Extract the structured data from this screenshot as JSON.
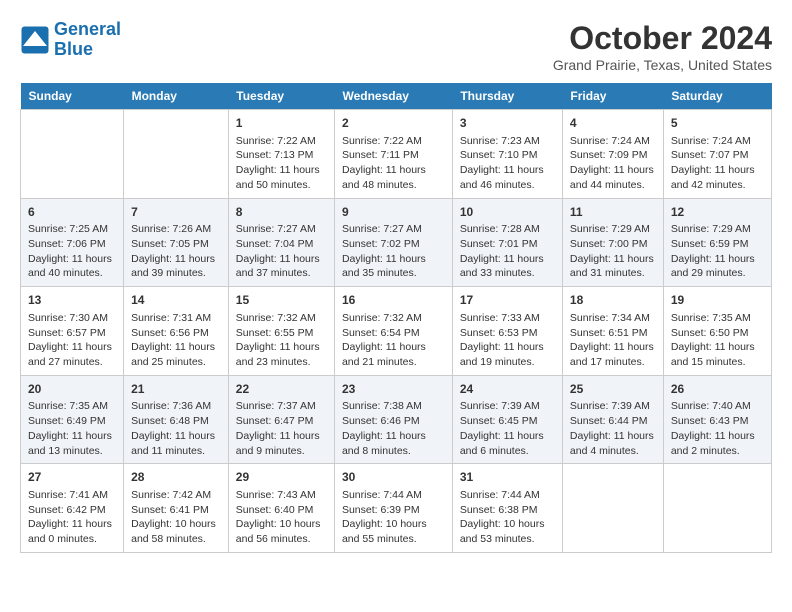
{
  "logo": {
    "line1": "General",
    "line2": "Blue"
  },
  "title": "October 2024",
  "subtitle": "Grand Prairie, Texas, United States",
  "headers": [
    "Sunday",
    "Monday",
    "Tuesday",
    "Wednesday",
    "Thursday",
    "Friday",
    "Saturday"
  ],
  "weeks": [
    [
      {
        "day": "",
        "info": ""
      },
      {
        "day": "",
        "info": ""
      },
      {
        "day": "1",
        "info": "Sunrise: 7:22 AM\nSunset: 7:13 PM\nDaylight: 11 hours and 50 minutes."
      },
      {
        "day": "2",
        "info": "Sunrise: 7:22 AM\nSunset: 7:11 PM\nDaylight: 11 hours and 48 minutes."
      },
      {
        "day": "3",
        "info": "Sunrise: 7:23 AM\nSunset: 7:10 PM\nDaylight: 11 hours and 46 minutes."
      },
      {
        "day": "4",
        "info": "Sunrise: 7:24 AM\nSunset: 7:09 PM\nDaylight: 11 hours and 44 minutes."
      },
      {
        "day": "5",
        "info": "Sunrise: 7:24 AM\nSunset: 7:07 PM\nDaylight: 11 hours and 42 minutes."
      }
    ],
    [
      {
        "day": "6",
        "info": "Sunrise: 7:25 AM\nSunset: 7:06 PM\nDaylight: 11 hours and 40 minutes."
      },
      {
        "day": "7",
        "info": "Sunrise: 7:26 AM\nSunset: 7:05 PM\nDaylight: 11 hours and 39 minutes."
      },
      {
        "day": "8",
        "info": "Sunrise: 7:27 AM\nSunset: 7:04 PM\nDaylight: 11 hours and 37 minutes."
      },
      {
        "day": "9",
        "info": "Sunrise: 7:27 AM\nSunset: 7:02 PM\nDaylight: 11 hours and 35 minutes."
      },
      {
        "day": "10",
        "info": "Sunrise: 7:28 AM\nSunset: 7:01 PM\nDaylight: 11 hours and 33 minutes."
      },
      {
        "day": "11",
        "info": "Sunrise: 7:29 AM\nSunset: 7:00 PM\nDaylight: 11 hours and 31 minutes."
      },
      {
        "day": "12",
        "info": "Sunrise: 7:29 AM\nSunset: 6:59 PM\nDaylight: 11 hours and 29 minutes."
      }
    ],
    [
      {
        "day": "13",
        "info": "Sunrise: 7:30 AM\nSunset: 6:57 PM\nDaylight: 11 hours and 27 minutes."
      },
      {
        "day": "14",
        "info": "Sunrise: 7:31 AM\nSunset: 6:56 PM\nDaylight: 11 hours and 25 minutes."
      },
      {
        "day": "15",
        "info": "Sunrise: 7:32 AM\nSunset: 6:55 PM\nDaylight: 11 hours and 23 minutes."
      },
      {
        "day": "16",
        "info": "Sunrise: 7:32 AM\nSunset: 6:54 PM\nDaylight: 11 hours and 21 minutes."
      },
      {
        "day": "17",
        "info": "Sunrise: 7:33 AM\nSunset: 6:53 PM\nDaylight: 11 hours and 19 minutes."
      },
      {
        "day": "18",
        "info": "Sunrise: 7:34 AM\nSunset: 6:51 PM\nDaylight: 11 hours and 17 minutes."
      },
      {
        "day": "19",
        "info": "Sunrise: 7:35 AM\nSunset: 6:50 PM\nDaylight: 11 hours and 15 minutes."
      }
    ],
    [
      {
        "day": "20",
        "info": "Sunrise: 7:35 AM\nSunset: 6:49 PM\nDaylight: 11 hours and 13 minutes."
      },
      {
        "day": "21",
        "info": "Sunrise: 7:36 AM\nSunset: 6:48 PM\nDaylight: 11 hours and 11 minutes."
      },
      {
        "day": "22",
        "info": "Sunrise: 7:37 AM\nSunset: 6:47 PM\nDaylight: 11 hours and 9 minutes."
      },
      {
        "day": "23",
        "info": "Sunrise: 7:38 AM\nSunset: 6:46 PM\nDaylight: 11 hours and 8 minutes."
      },
      {
        "day": "24",
        "info": "Sunrise: 7:39 AM\nSunset: 6:45 PM\nDaylight: 11 hours and 6 minutes."
      },
      {
        "day": "25",
        "info": "Sunrise: 7:39 AM\nSunset: 6:44 PM\nDaylight: 11 hours and 4 minutes."
      },
      {
        "day": "26",
        "info": "Sunrise: 7:40 AM\nSunset: 6:43 PM\nDaylight: 11 hours and 2 minutes."
      }
    ],
    [
      {
        "day": "27",
        "info": "Sunrise: 7:41 AM\nSunset: 6:42 PM\nDaylight: 11 hours and 0 minutes."
      },
      {
        "day": "28",
        "info": "Sunrise: 7:42 AM\nSunset: 6:41 PM\nDaylight: 10 hours and 58 minutes."
      },
      {
        "day": "29",
        "info": "Sunrise: 7:43 AM\nSunset: 6:40 PM\nDaylight: 10 hours and 56 minutes."
      },
      {
        "day": "30",
        "info": "Sunrise: 7:44 AM\nSunset: 6:39 PM\nDaylight: 10 hours and 55 minutes."
      },
      {
        "day": "31",
        "info": "Sunrise: 7:44 AM\nSunset: 6:38 PM\nDaylight: 10 hours and 53 minutes."
      },
      {
        "day": "",
        "info": ""
      },
      {
        "day": "",
        "info": ""
      }
    ]
  ]
}
